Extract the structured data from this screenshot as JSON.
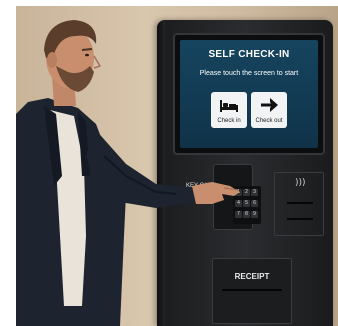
{
  "screen": {
    "title": "SELF CHECK-IN",
    "subtitle": "Please touch the screen to start",
    "buttons": [
      {
        "label": "Check in",
        "icon": "bed-icon"
      },
      {
        "label": "Check out",
        "icon": "arrow-right-icon"
      }
    ]
  },
  "kiosk": {
    "key_card_label": "KEY CARD",
    "receipt_label": "RECEIPT",
    "contactless_icon": "contactless-icon",
    "keypad_keys": [
      "1",
      "2",
      "3",
      "4",
      "5",
      "6",
      "7",
      "8",
      "9"
    ]
  },
  "colors": {
    "screen_bg": "#16445e",
    "kiosk_body": "#2b2c2f",
    "wall": "#d8c6ad"
  }
}
